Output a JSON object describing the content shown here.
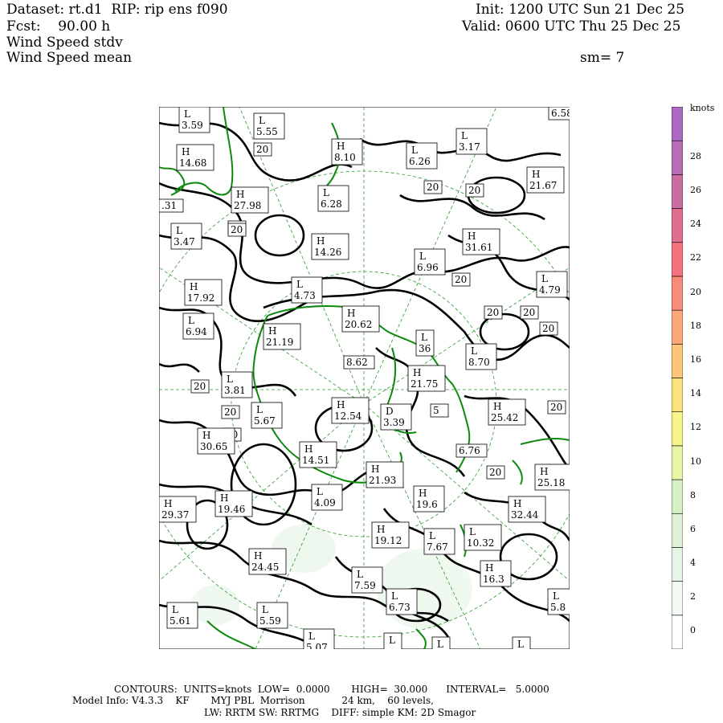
{
  "header": {
    "dataset_line": "Dataset: rt.d1  RIP: rip ens f090",
    "fcst_line": "Fcst:    90.00 h",
    "field1": "Wind Speed stdv",
    "field2": "Wind Speed mean",
    "init_line": "Init: 1200 UTC Sun 21 Dec 25",
    "valid_line": "Valid: 0600 UTC Thu 25 Dec 25",
    "smooth": "sm= 7"
  },
  "colorbar": {
    "unit": "knots",
    "labels": [
      "28",
      "26",
      "24",
      "22",
      "20",
      "18",
      "16",
      "14",
      "12",
      "10",
      "8",
      "6",
      "4",
      "2",
      "0"
    ],
    "colors": [
      "#ffffff",
      "#f3f9f3",
      "#e7f5e7",
      "#dff2d6",
      "#d4f0c4",
      "#e6f5a8",
      "#f7f58a",
      "#fbe27a",
      "#fcc67a",
      "#fba97a",
      "#f98b7a",
      "#f5737f",
      "#e06e8c",
      "#c96fa0",
      "#b86cb8",
      "#ad6ac2"
    ]
  },
  "map_labels": [
    {
      "t": "L",
      "v": "3.59"
    },
    {
      "t": "L",
      "v": "5.55"
    },
    {
      "t": "",
      "v": "6.58"
    },
    {
      "t": "H",
      "v": "14.68"
    },
    {
      "t": "",
      "v": "20"
    },
    {
      "t": "H",
      "v": "8.10"
    },
    {
      "t": "L",
      "v": "6.26"
    },
    {
      "t": "L",
      "v": "3.17"
    },
    {
      "t": "H",
      "v": "21.67"
    },
    {
      "t": "",
      "v": "20"
    },
    {
      "t": "H",
      "v": "27.98"
    },
    {
      "t": "L",
      "v": "6.28"
    },
    {
      "t": "",
      "v": "20"
    },
    {
      "t": "",
      "v": "20"
    },
    {
      "t": "",
      "v": ".31"
    },
    {
      "t": "L",
      "v": "3.47"
    },
    {
      "t": "",
      "v": "20"
    },
    {
      "t": "H",
      "v": "14.26"
    },
    {
      "t": "H",
      "v": "31.61"
    },
    {
      "t": "L",
      "v": "6.96"
    },
    {
      "t": "L",
      "v": "4.79"
    },
    {
      "t": "H",
      "v": "17.92"
    },
    {
      "t": "L",
      "v": "4.73"
    },
    {
      "t": "",
      "v": "20"
    },
    {
      "t": "",
      "v": "20"
    },
    {
      "t": "H",
      "v": "20.62"
    },
    {
      "t": "",
      "v": "20"
    },
    {
      "t": "",
      "v": "20"
    },
    {
      "t": "L",
      "v": "6.94"
    },
    {
      "t": "H",
      "v": "21.19"
    },
    {
      "t": "L",
      "v": "36"
    },
    {
      "t": "L",
      "v": "8.70"
    },
    {
      "t": "",
      "v": "8.62"
    },
    {
      "t": "L",
      "v": "3.81"
    },
    {
      "t": "H",
      "v": "21.75"
    },
    {
      "t": "",
      "v": "20"
    },
    {
      "t": "",
      "v": "20"
    },
    {
      "t": "H",
      "v": "12.54"
    },
    {
      "t": "",
      "v": "20"
    },
    {
      "t": "L",
      "v": "5.67"
    },
    {
      "t": "D",
      "v": "3.39"
    },
    {
      "t": "",
      "v": "5"
    },
    {
      "t": "H",
      "v": "25.42"
    },
    {
      "t": "",
      "v": "20"
    },
    {
      "t": "H",
      "v": "30.65"
    },
    {
      "t": "H",
      "v": "14.51"
    },
    {
      "t": "",
      "v": "6.76"
    },
    {
      "t": "H",
      "v": "21.93"
    },
    {
      "t": "",
      "v": "20"
    },
    {
      "t": "H",
      "v": "25.18"
    },
    {
      "t": "H",
      "v": "29.37"
    },
    {
      "t": "H",
      "v": "19.46"
    },
    {
      "t": "L",
      "v": "4.09"
    },
    {
      "t": "H",
      "v": "19.6"
    },
    {
      "t": "H",
      "v": "32.44"
    },
    {
      "t": "H",
      "v": "19.12"
    },
    {
      "t": "L",
      "v": "7.67"
    },
    {
      "t": "L",
      "v": "10.32"
    },
    {
      "t": "H",
      "v": "24.45"
    },
    {
      "t": "H",
      "v": "16.3"
    },
    {
      "t": "L",
      "v": "7.59"
    },
    {
      "t": "L",
      "v": "6.73"
    },
    {
      "t": "L",
      "v": "5.8"
    },
    {
      "t": "L",
      "v": "5.61"
    },
    {
      "t": "L",
      "v": "5.59"
    },
    {
      "t": "L",
      "v": "5.07"
    },
    {
      "t": "L",
      "v": ""
    },
    {
      "t": "L",
      "v": ""
    },
    {
      "t": "L",
      "v": ""
    }
  ],
  "footer": {
    "line1": "CONTOURS:  UNITS=knots  LOW=  0.0000       HIGH=  30.000      INTERVAL=   5.0000",
    "line2": "Model Info: V4.3.3    KF       MYJ PBL  Morrison            24 km,    60 levels,",
    "line3": "LW: RRTM SW: RRTMG    DIFF: simple KM: 2D Smagor"
  }
}
